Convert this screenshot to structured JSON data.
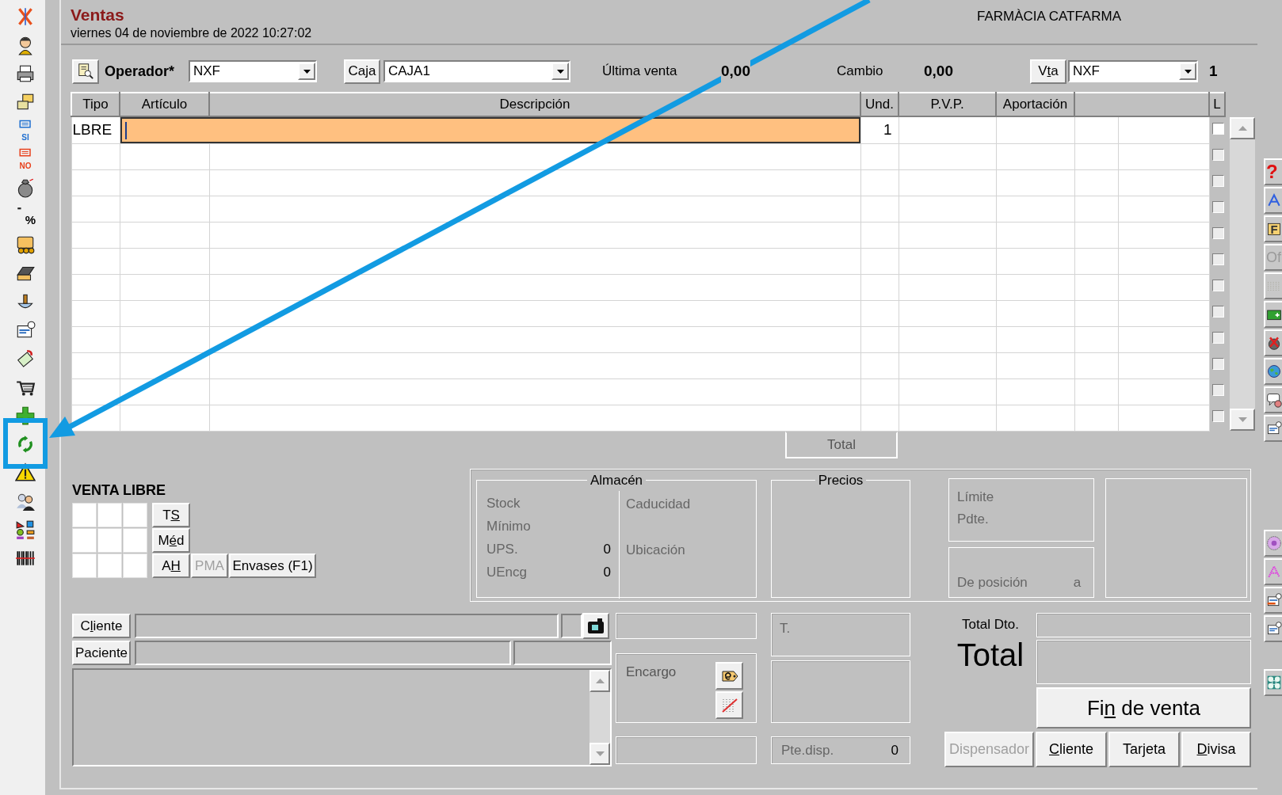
{
  "window": {
    "title": "Ventas",
    "datetime": "viernes 04 de noviembre de 2022 10:27:02",
    "company": "FARMÀCIA CATFARMA"
  },
  "left_toolbar": [
    {
      "kind": "close"
    },
    {
      "kind": "person"
    },
    {
      "kind": "printer"
    },
    {
      "kind": "windows"
    },
    {
      "kind": "message",
      "label": "SI",
      "color": "#1f6fd0"
    },
    {
      "kind": "message",
      "label": "NO",
      "color": "#e8401c"
    },
    {
      "kind": "money_bag"
    },
    {
      "kind": "percent",
      "label": "%"
    },
    {
      "kind": "coupon"
    },
    {
      "kind": "scanner"
    },
    {
      "kind": "scale"
    },
    {
      "kind": "card"
    },
    {
      "kind": "ticket"
    },
    {
      "kind": "cart"
    },
    {
      "kind": "plus"
    },
    {
      "kind": "refresh"
    },
    {
      "kind": "warning"
    },
    {
      "kind": "users"
    },
    {
      "kind": "diagram"
    },
    {
      "kind": "barcode"
    }
  ],
  "toolbar": {
    "operator": {
      "label": "Operador*",
      "value": "NXF"
    },
    "till": {
      "button": "Caja",
      "value": "CAJA1"
    },
    "last_sale": {
      "label": "Última venta",
      "value": "0,00"
    },
    "change": {
      "label": "Cambio",
      "value": "0,00"
    },
    "sale": {
      "button": {
        "pre": "V",
        "key": "t",
        "post": "a"
      },
      "value": "NXF",
      "count": "1"
    }
  },
  "grid": {
    "columns": [
      "Tipo",
      "Artículo",
      "Descripción",
      "Und.",
      "P.V.P.",
      "Aportación"
    ],
    "check_column": "L",
    "rows": [
      {
        "type": "LBRE",
        "units": "1",
        "editing": true,
        "checked": false,
        "disabled": false
      },
      {
        "editing": false,
        "checked": false,
        "disabled": true
      },
      {
        "editing": false,
        "checked": false,
        "disabled": true
      },
      {
        "editing": false,
        "checked": false,
        "disabled": true
      },
      {
        "editing": false,
        "checked": false,
        "disabled": true
      },
      {
        "editing": false,
        "checked": false,
        "disabled": true
      },
      {
        "editing": false,
        "checked": false,
        "disabled": true
      },
      {
        "editing": false,
        "checked": false,
        "disabled": true
      },
      {
        "editing": false,
        "checked": false,
        "disabled": true
      },
      {
        "editing": false,
        "checked": false,
        "disabled": true
      },
      {
        "editing": false,
        "checked": false,
        "disabled": true
      },
      {
        "editing": false,
        "checked": false,
        "disabled": true
      }
    ],
    "total_label": "Total"
  },
  "free_sale": {
    "title": "VENTA LIBRE",
    "buttons": [
      {
        "label": {
          "pre": "T",
          "key": "S"
        },
        "disabled": false
      },
      {
        "label": {
          "pre": "M",
          "key": "é",
          "post": "d"
        },
        "disabled": false
      },
      {
        "label": {
          "pre": "A",
          "key": "H"
        },
        "disabled": false
      },
      {
        "label": "PMA",
        "disabled": true
      },
      {
        "label": "Envases (F1)",
        "disabled": false
      }
    ]
  },
  "warehouse": {
    "title": "Almacén",
    "stats": [
      {
        "label": "Stock"
      },
      {
        "label": "Mínimo"
      },
      {
        "label": "UPS.",
        "value": "0"
      },
      {
        "label": "UEncg",
        "value": "0"
      }
    ],
    "details": [
      "Caducidad",
      "Ubicación"
    ]
  },
  "prices": {
    "title": "Precios"
  },
  "credit": {
    "labels": [
      "Límite",
      "Pdte."
    ],
    "position_label": "De posición",
    "position_to": "a"
  },
  "customer": {
    "client_button": {
      "pre": "C",
      "key": "l",
      "post": "iente"
    },
    "patient_button": "Paciente"
  },
  "order": {
    "label": "Encargo"
  },
  "t_box": {
    "label": "T."
  },
  "pending": {
    "label": "Pte.disp.",
    "value": "0"
  },
  "totals": {
    "discount_label": "Total Dto.",
    "total_label": "Total",
    "finish_button": {
      "pre": "Fi",
      "key": "n",
      "post": " de venta"
    },
    "buttons": [
      {
        "label": "Dispensador",
        "disabled": true
      },
      {
        "label": {
          "key": "C",
          "post": "liente"
        },
        "disabled": false
      },
      {
        "label": {
          "pre": "Tar",
          "key": "j",
          "post": "eta"
        },
        "disabled": false
      },
      {
        "label": {
          "key": "D",
          "post": "ivisa"
        },
        "disabled": false
      }
    ]
  },
  "right_toolbar": [
    [
      {
        "kind": "help",
        "label": "?"
      },
      {
        "kind": "chevron"
      },
      {
        "kind": "f_box",
        "label": "F"
      },
      {
        "kind": "text",
        "label": "Of"
      },
      {
        "kind": "dots"
      },
      {
        "kind": "money_add"
      },
      {
        "kind": "cancel"
      },
      {
        "kind": "globe"
      },
      {
        "kind": "chat"
      },
      {
        "kind": "card"
      }
    ],
    [
      {
        "kind": "disc"
      },
      {
        "kind": "chevron_pink"
      },
      {
        "kind": "card_out"
      },
      {
        "kind": "card"
      }
    ],
    [
      {
        "kind": "pattern"
      }
    ]
  ]
}
